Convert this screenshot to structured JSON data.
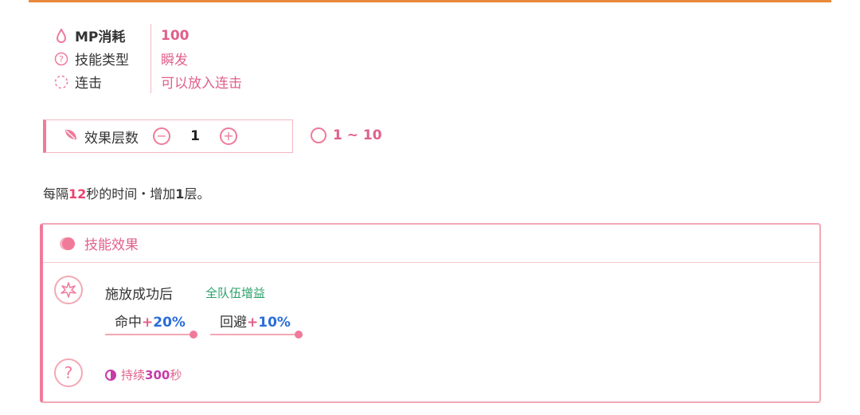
{
  "info": {
    "rows": [
      {
        "key": "MP消耗",
        "value": "100",
        "icon": "drop-icon"
      },
      {
        "key": "技能类型",
        "value": "瞬发",
        "icon": "question-circle-icon"
      },
      {
        "key": "连击",
        "value": "可以放入连击",
        "icon": "dashed-circle-icon"
      }
    ]
  },
  "stepper": {
    "label": "效果层数",
    "value": "1",
    "minus": "−",
    "plus": "+",
    "icon": "leaf-icon"
  },
  "range": {
    "text": "1 ~ 10"
  },
  "desc": {
    "pre": "每隔",
    "num": "12",
    "mid": "秒的时间・增加",
    "num2": "1",
    "post": "层。"
  },
  "card": {
    "title": "技能效果",
    "cast": "施放成功后",
    "team": "全队伍增益",
    "stats": [
      {
        "label": "命中",
        "plus": "+",
        "value": "20%"
      },
      {
        "label": "回避",
        "plus": "+",
        "value": "10%"
      }
    ],
    "question": "?",
    "duration": {
      "pre": "持续",
      "num": "300",
      "post": "秒"
    }
  },
  "colors": {
    "accent": "#f07a9a",
    "orange": "#e8893a",
    "blue": "#2a6ed8",
    "green": "#2aa06a",
    "purple": "#c73aa8"
  }
}
